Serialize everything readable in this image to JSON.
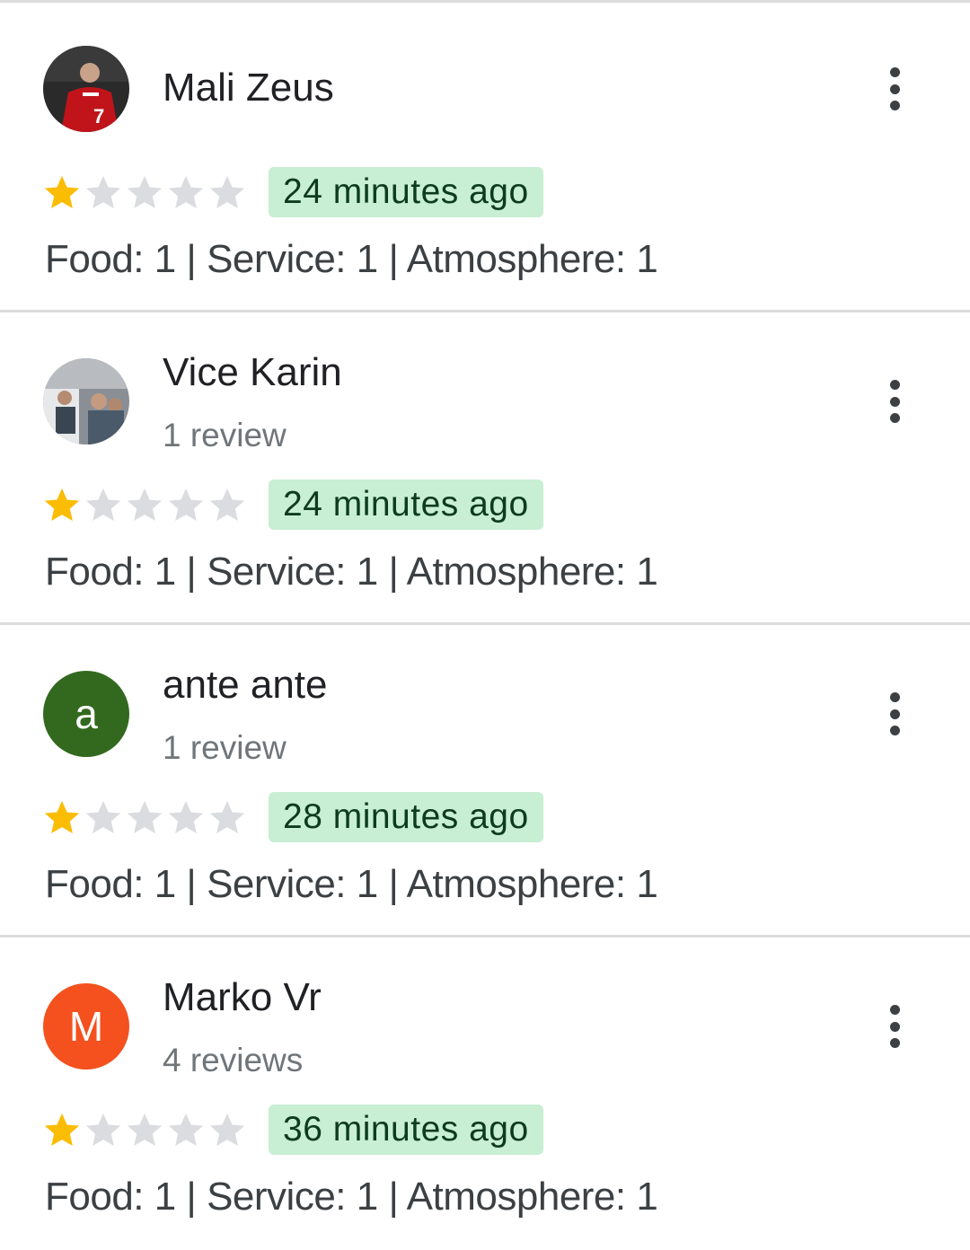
{
  "reviews": [
    {
      "name": "Mali Zeus",
      "review_count": "",
      "avatar": {
        "type": "photo",
        "icon": "photo-avatar-red-jersey",
        "bg": "#2a2a2a"
      },
      "stars_filled": 1,
      "stars_total": 5,
      "time": "24 minutes ago",
      "sub_ratings": "Food: 1 | Service: 1 | Atmosphere: 1"
    },
    {
      "name": "Vice Karin",
      "review_count": "1 review",
      "avatar": {
        "type": "photo",
        "icon": "photo-avatar-group",
        "bg": "#8a8f96"
      },
      "stars_filled": 1,
      "stars_total": 5,
      "time": "24 minutes ago",
      "sub_ratings": "Food: 1 | Service: 1 | Atmosphere: 1"
    },
    {
      "name": "ante ante",
      "review_count": "1 review",
      "avatar": {
        "type": "letter",
        "letter": "a",
        "bg": "#33691e"
      },
      "stars_filled": 1,
      "stars_total": 5,
      "time": "28 minutes ago",
      "sub_ratings": "Food: 1 | Service: 1 | Atmosphere: 1"
    },
    {
      "name": "Marko Vr",
      "review_count": "4 reviews",
      "avatar": {
        "type": "letter",
        "letter": "M",
        "bg": "#f4511e"
      },
      "stars_filled": 1,
      "stars_total": 5,
      "time": "36 minutes ago",
      "sub_ratings": "Food: 1 | Service: 1 | Atmosphere: 1"
    }
  ],
  "colors": {
    "star_filled": "#fbbc04",
    "star_empty": "#dadce0",
    "time_badge_bg": "#c8eed3",
    "divider": "#dcdcdc"
  },
  "icons": {
    "more": "more-vert-icon",
    "star": "star-icon"
  }
}
